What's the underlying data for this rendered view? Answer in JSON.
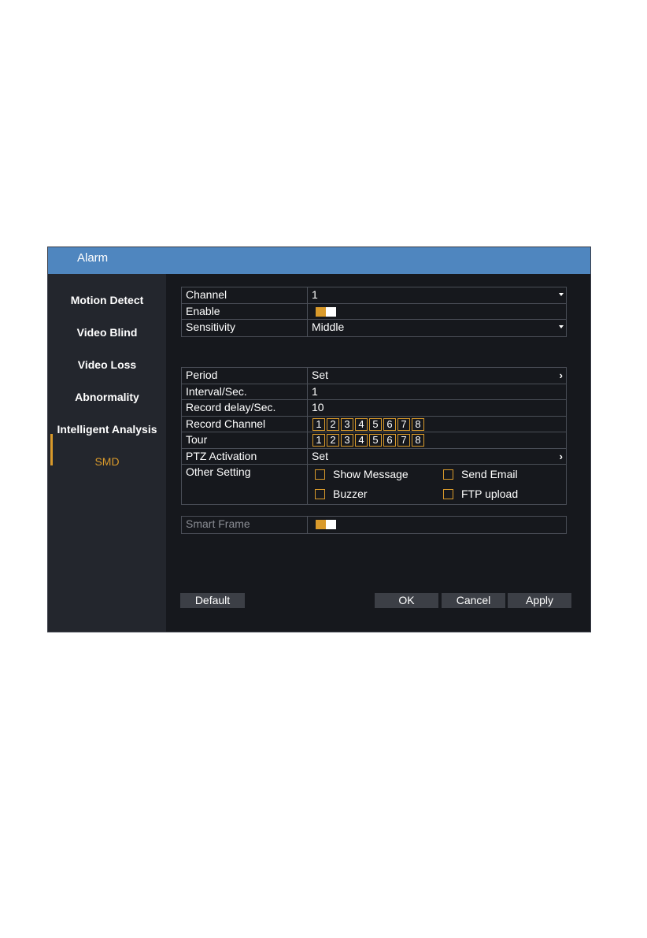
{
  "window": {
    "title": "Alarm"
  },
  "sidebar": {
    "items": [
      {
        "label": "Motion Detect"
      },
      {
        "label": "Video Blind"
      },
      {
        "label": "Video Loss"
      },
      {
        "label": "Abnormality"
      },
      {
        "label": "Intelligent Analysis"
      },
      {
        "label": "SMD",
        "active": true
      }
    ]
  },
  "basic": {
    "channel_label": "Channel",
    "channel_value": "1",
    "enable_label": "Enable",
    "enable_on": true,
    "sensitivity_label": "Sensitivity",
    "sensitivity_value": "Middle"
  },
  "linkage": {
    "period_label": "Period",
    "period_value": "Set",
    "interval_label": "Interval/Sec.",
    "interval_value": "1",
    "record_delay_label": "Record delay/Sec.",
    "record_delay_value": "10",
    "record_channel_label": "Record Channel",
    "record_channels": [
      "1",
      "2",
      "3",
      "4",
      "5",
      "6",
      "7",
      "8"
    ],
    "tour_label": "Tour",
    "tour_channels": [
      "1",
      "2",
      "3",
      "4",
      "5",
      "6",
      "7",
      "8"
    ],
    "ptz_label": "PTZ Activation",
    "ptz_value": "Set",
    "other_label": "Other Setting",
    "show_message": "Show Message",
    "send_email": "Send Email",
    "buzzer": "Buzzer",
    "ftp_upload": "FTP upload"
  },
  "smart": {
    "label": "Smart Frame",
    "on": true
  },
  "buttons": {
    "default": "Default",
    "ok": "OK",
    "cancel": "Cancel",
    "apply": "Apply"
  },
  "colors": {
    "accent": "#d99a2b",
    "titlebar": "#4f86bf",
    "background": "#16181d",
    "sidebar": "#23262d"
  }
}
